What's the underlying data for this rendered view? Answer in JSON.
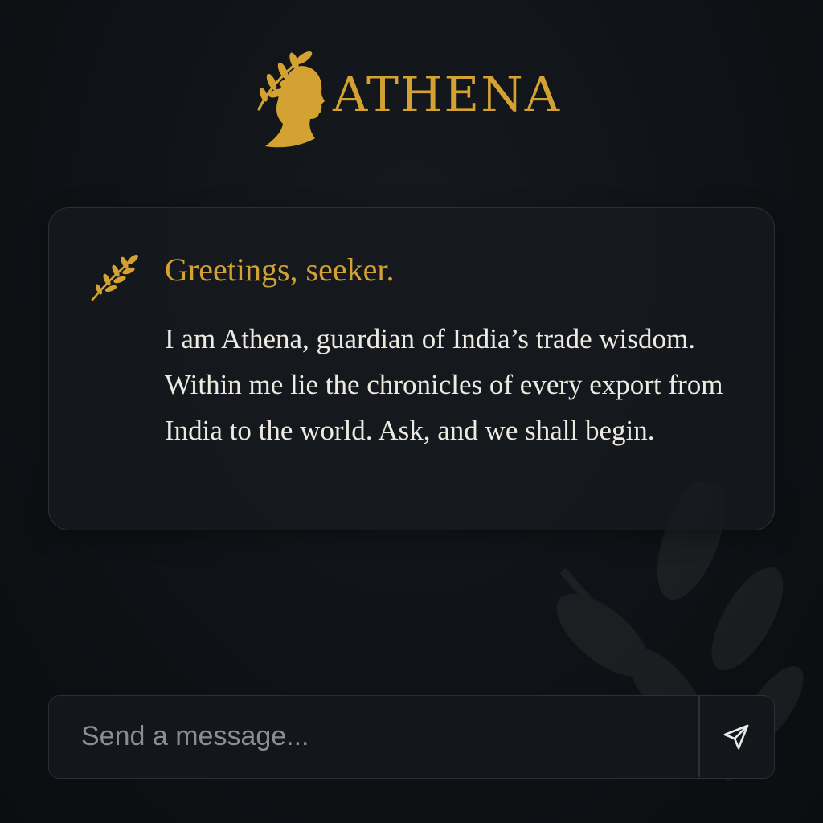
{
  "brand": {
    "name": "ATHENA",
    "logo_icon": "athena-profile-laurel-icon",
    "accent_color": "#d4a232"
  },
  "message": {
    "icon": "laurel-branch-icon",
    "greeting": "Greetings, seeker.",
    "body": "I am Athena, guardian of India’s trade wisdom. Within me lie the chronicles of every export from India to the world. Ask, and we shall begin."
  },
  "composer": {
    "placeholder": "Send a message...",
    "value": "",
    "send_icon": "send-arrow-icon"
  },
  "colors": {
    "background": "#0f1216",
    "card_border": "#2b3037",
    "body_text": "#eeeae2",
    "placeholder_text": "#8a8d92"
  }
}
